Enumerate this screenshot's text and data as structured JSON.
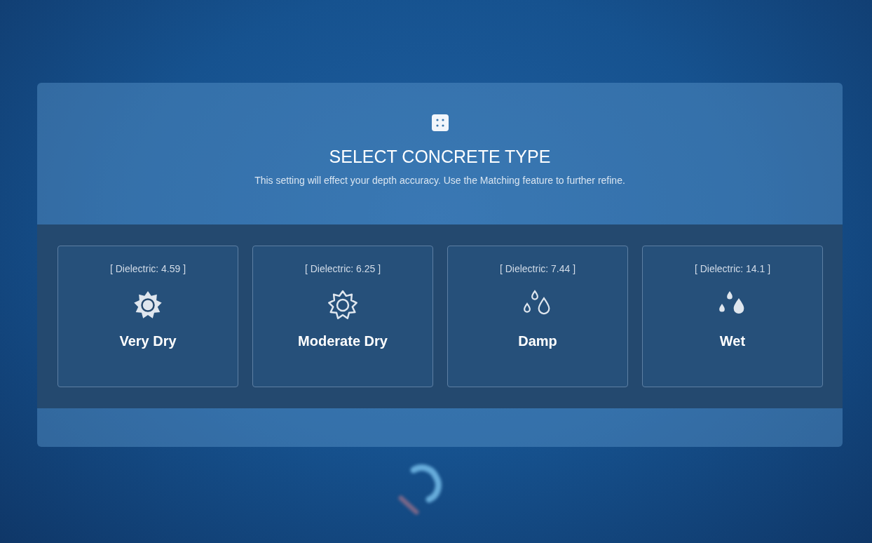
{
  "dialog": {
    "title": "SELECT CONCRETE TYPE",
    "subtitle": "This setting will effect your depth accuracy. Use the Matching feature to further refine.",
    "options": [
      {
        "kind": "sun-filled",
        "dielectric": "[ Dielectric: 4.59 ]",
        "label": "Very Dry"
      },
      {
        "kind": "sun-outline",
        "dielectric": "[ Dielectric: 6.25 ]",
        "label": "Moderate Dry"
      },
      {
        "kind": "drops-outline",
        "dielectric": "[ Dielectric: 7.44 ]",
        "label": "Damp"
      },
      {
        "kind": "drops-filled",
        "dielectric": "[ Dielectric: 14.1 ]",
        "label": "Wet"
      }
    ]
  }
}
